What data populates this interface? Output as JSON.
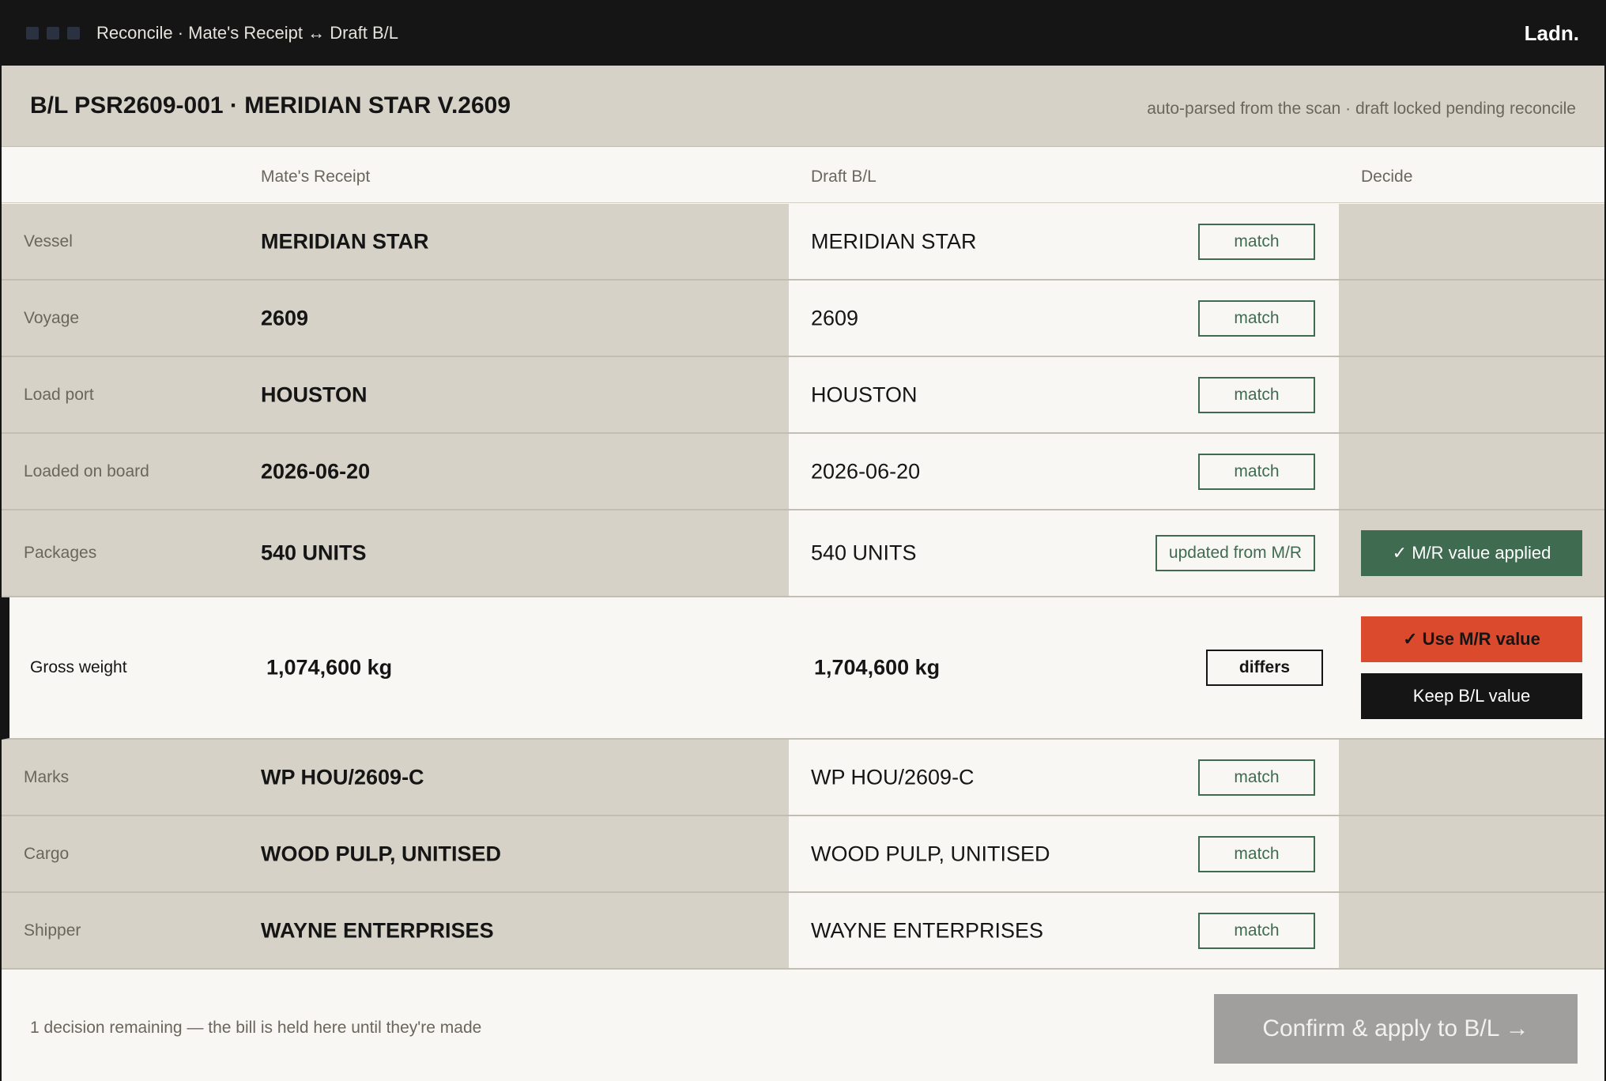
{
  "topbar": {
    "title": "Reconcile · Mate's Receipt ↔ Draft B/L",
    "brand": "Ladn.",
    "window_dots_color": "#2a3140"
  },
  "header": {
    "title": "B/L PSR2609-001 · MERIDIAN STAR V.2609",
    "note": "auto-parsed from the scan · draft locked pending reconcile"
  },
  "columns": {
    "mate_receipt": "Mate's Receipt",
    "draft_bl": "Draft B/L",
    "decide": "Decide"
  },
  "rows": [
    {
      "label": "Vessel",
      "mr": "MERIDIAN STAR",
      "bl": "MERIDIAN STAR",
      "status": "match"
    },
    {
      "label": "Voyage",
      "mr": "2609",
      "bl": "2609",
      "status": "match"
    },
    {
      "label": "Load port",
      "mr": "HOUSTON",
      "bl": "HOUSTON",
      "status": "match"
    },
    {
      "label": "Loaded on board",
      "mr": "2026-06-20",
      "bl": "2026-06-20",
      "status": "match"
    },
    {
      "label": "Packages",
      "mr": "540 UNITS",
      "bl": "540 UNITS",
      "status": "updated from M/R",
      "decision": "✓ M/R value applied"
    },
    {
      "label": "Gross weight",
      "mr": "1,074,600 kg",
      "bl": "1,704,600 kg",
      "status": "differs",
      "use_mr": "✓ Use M/R value",
      "keep_bl": "Keep B/L value"
    },
    {
      "label": "Marks",
      "mr": "WP HOU/2609-C",
      "bl": "WP HOU/2609-C",
      "status": "match"
    },
    {
      "label": "Cargo",
      "mr": "WOOD PULP, UNITISED",
      "bl": "WOOD PULP, UNITISED",
      "status": "match"
    },
    {
      "label": "Shipper",
      "mr": "WAYNE ENTERPRISES",
      "bl": "WAYNE ENTERPRISES",
      "status": "match"
    }
  ],
  "footer": {
    "remaining": "1 decision remaining — the bill is held here until they're made",
    "confirm": "Confirm & apply to B/L →"
  },
  "colors": {
    "accent_green": "#3f6b50",
    "accent_red": "#dc4a2e",
    "panel_beige": "#d7d2c7",
    "confirm_disabled": "#a09f9d"
  }
}
